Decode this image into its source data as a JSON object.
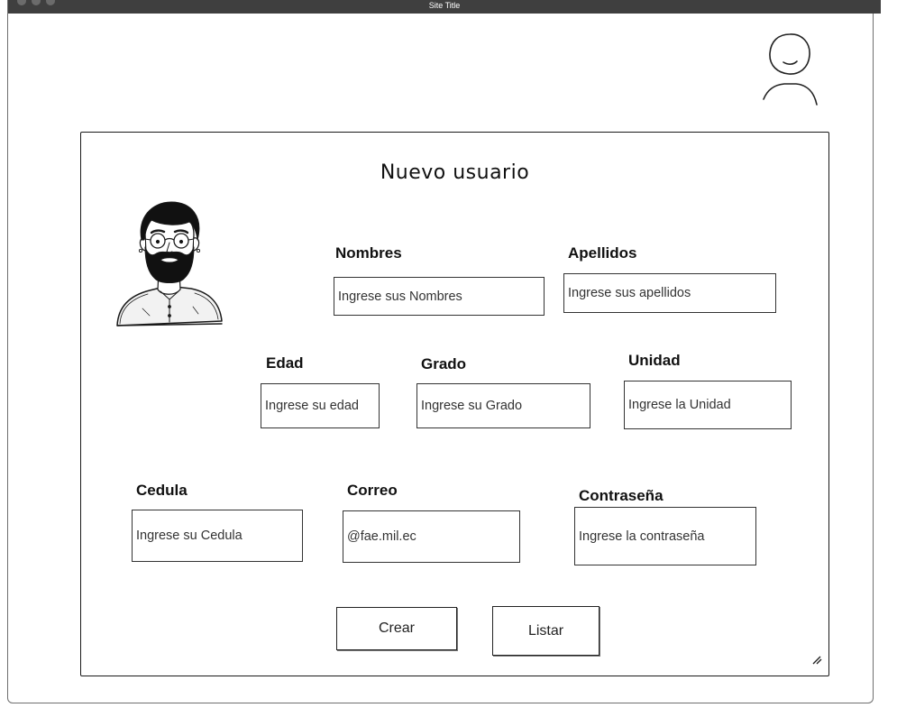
{
  "window": {
    "title": "Site Title"
  },
  "form": {
    "title": "Nuevo usuario",
    "fields": {
      "nombres": {
        "label": "Nombres",
        "placeholder": "Ingrese sus Nombres"
      },
      "apellidos": {
        "label": "Apellidos",
        "placeholder": "Ingrese sus apellidos"
      },
      "edad": {
        "label": "Edad",
        "placeholder": "Ingrese su edad"
      },
      "grado": {
        "label": "Grado",
        "placeholder": "Ingrese su Grado"
      },
      "unidad": {
        "label": "Unidad",
        "placeholder": "Ingrese la Unidad"
      },
      "cedula": {
        "label": "Cedula",
        "placeholder": "Ingrese su Cedula"
      },
      "correo": {
        "label": "Correo",
        "placeholder": "@fae.mil.ec"
      },
      "contrasena": {
        "label": "Contraseña",
        "placeholder": "Ingrese la contraseña"
      }
    },
    "buttons": {
      "create": "Crear",
      "list": "Listar"
    }
  },
  "icons": {
    "profile": "user-profile-icon",
    "avatar": "bearded-man-avatar",
    "resize": "resize-handle-icon"
  },
  "colors": {
    "titlebar": "#3f3f3f",
    "border": "#1a1a1a",
    "background": "#ffffff"
  }
}
